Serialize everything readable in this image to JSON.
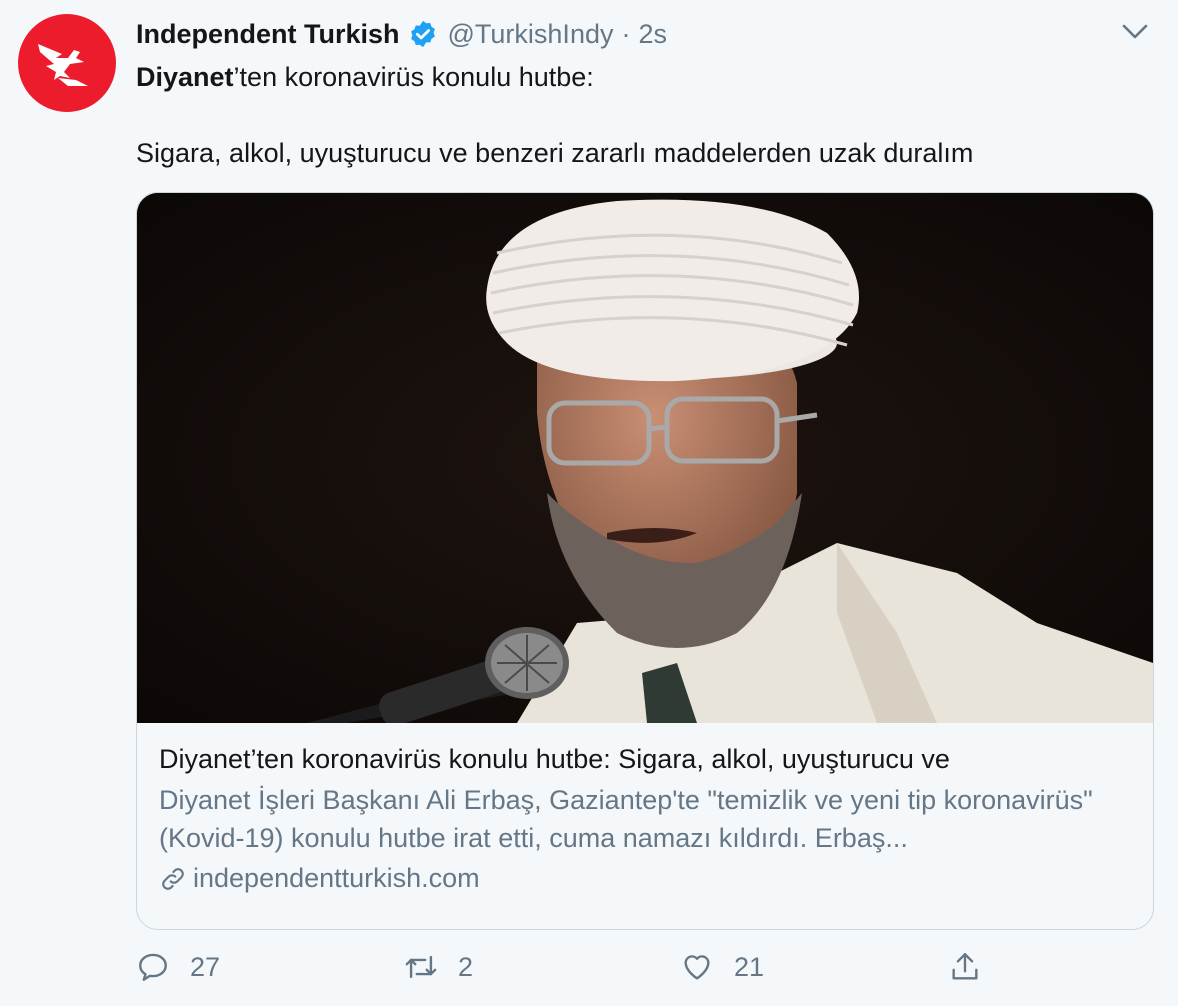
{
  "tweet": {
    "author_name": "Independent Turkish",
    "handle": "@TurkishIndy",
    "separator": "·",
    "time": "2s",
    "text_bold": "Diyanet",
    "text_rest": "’ten koronavirüs konulu hutbe:",
    "text_line2": "Sigara, alkol, uyuşturucu ve benzeri zararlı maddelerden uzak duralım",
    "icons": {
      "avatar": "independent-eagle-logo",
      "verified": "verified-badge-icon",
      "menu": "chevron-down-icon"
    },
    "colors": {
      "brand_red": "#ec1c2d",
      "verified_blue": "#1da1f2",
      "secondary_text": "#657786",
      "background": "#f5f8fa"
    }
  },
  "card": {
    "title": "Diyanet’ten koronavirüs konulu hutbe: Sigara, alkol, uyuşturucu ve",
    "description": "Diyanet İşleri Başkanı Ali Erbaş, Gaziantep'te \"temizlik ve yeni tip koronavirüs\" (Kovid-19) konulu hutbe irat etti, cuma namazı kıldırdı. Erbaş...",
    "domain": "independentturkish.com",
    "image_subject": "man in white turban speaking into microphone"
  },
  "actions": {
    "reply_count": "27",
    "retweet_count": "2",
    "like_count": "21"
  }
}
